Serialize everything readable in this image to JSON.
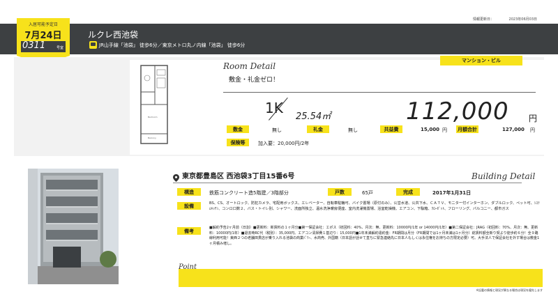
{
  "header": {
    "move_in_label": "入居可能予定日",
    "move_in_date": "7月24日",
    "room_number": "0311",
    "room_suffix": "号室",
    "info_updated_label": "情報更新日：",
    "info_updated_value": "2023年06月03日",
    "building_name": "ルクレ西池袋",
    "access": "JR山手線「池袋」 徒歩6分／東京メトロ丸ノ内線「池袋」 徒歩6分"
  },
  "room": {
    "detail_title": "Room Detail",
    "type_badge": "マンション・ビル",
    "catchcopy": "敷金・礼金ゼロ！",
    "layout": "1K",
    "area": "25.54㎡",
    "rent": "112,000",
    "rent_unit": "円",
    "fees": [
      {
        "label": "敷金",
        "value": "無し"
      },
      {
        "label": "礼金",
        "value": "無し"
      },
      {
        "label": "共益費",
        "value": "15,000",
        "unit": "円"
      },
      {
        "label": "月額合計",
        "value": "127,000",
        "unit": "円"
      }
    ],
    "guarantee_label": "保険等",
    "guarantee_value": "加入要：20,000円/2年",
    "floorplan_labels": [
      "Bedroom",
      "Balcony"
    ]
  },
  "building": {
    "detail_title": "Building Detail",
    "address": "東京都豊島区 西池袋3丁目15番6号",
    "structure_label": "構造",
    "structure_value": "鉄筋コンクリート造5階建／3階部分",
    "units_label": "戸数",
    "units_value": "65戸",
    "completed_label": "完成",
    "completed_value": "2017年1月31日",
    "equipment_label": "設備",
    "equipment_text": "BS、CS、オートロック、防犯カメラ、宅配用ボックス、エレベーター、自転車駐輪可、バイク置場（原付のみ）、公営水道、公共下水、ＣＡＴＶ、モニター付インターホン、ダブルロック、ペット可、ｼｽﾃﾑｷｯﾁﾝ、コンロ口数２、バス・トイレ別、シャワー、洗面所独立、温水洗浄暖房便座、室内洗濯機置場、浴室乾燥機、エアコン、下駄箱、ｸﾛｰｾﾞｯﾄ、フローリング、バルコニー、都市ガス",
    "remarks_label": "備考",
    "remarks_text": "■解約予告2ヶ月前（日割）■更新料：新賃料の１ヶ月分■第一保証会社：エポス（初回料：40%、月次：無、更新料：10000円/1年 or 14000円/1年）■第二保証会社：JRAG（初回料：70%、月次：無、更新料：10000円/1年）■退去時RC代（税別）：35,000円、エアコン清掃費１基辺り：15,000円■1年未満解約違約金：FR期間は月分（FR期間では1ヶ月未満は1ヶ月分）総賃料額全新り契より徒歩約６分！全９路線利用可能！東西２つの老舗田貫店が乗り入れる池袋の商業ﾊﾟﾜｰ、水商売、外国籍（日本語が話せて直ちに緊急連絡先に日本人もしくは永住権をお持ちの方限定必要）可。大手法人で保証会社を外す場合は敷金1ヶ月積み増し。",
    "point_label": "Point",
    "footnote": "※記載の情報と現況が異なる場合は現況を優先します"
  },
  "colors": {
    "accent": "#f7e21b",
    "header_bg": "#3d4042",
    "panel_bg": "#f2f2f2"
  }
}
